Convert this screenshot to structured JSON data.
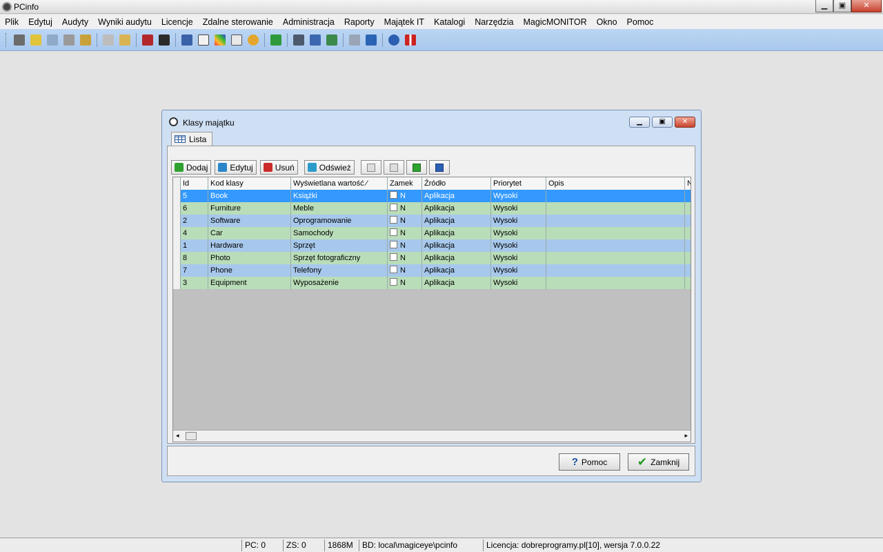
{
  "app": {
    "title": "PCinfo"
  },
  "window_controls": {
    "minimize": "▁",
    "maximize": "▣",
    "close": "✕"
  },
  "menu": [
    "Plik",
    "Edytuj",
    "Audyty",
    "Wyniki audytu",
    "Licencje",
    "Zdalne sterowanie",
    "Administracja",
    "Raporty",
    "Majątek IT",
    "Katalogi",
    "Narzędzia",
    "MagicMONITOR",
    "Okno",
    "Pomoc"
  ],
  "toolbar_icons": [
    "tools-icon",
    "upload-icon",
    "audit-icon",
    "search-icon",
    "wand-icon",
    "printer-icon",
    "chart-icon",
    "book-icon",
    "monitor-icon",
    "building-icon",
    "window-icon",
    "palette-icon",
    "list-icon",
    "user-icon",
    "money-icon",
    "network-icon",
    "computers-icon",
    "computers-alt-icon",
    "folder-icon",
    "doc-icon",
    "help-icon",
    "uk-flag-icon"
  ],
  "child_window": {
    "title": "Klasy majątku",
    "tab_label": "Lista",
    "buttons": {
      "add": "Dodaj",
      "edit": "Edytuj",
      "delete": "Usuń",
      "refresh": "Odśwież"
    },
    "columns": [
      "Id",
      "Kod klasy",
      "Wyświetlana wartość",
      "Zamek",
      "Źródło",
      "Priorytet",
      "Opis",
      "N"
    ],
    "sort_marker": "⁄",
    "rows": [
      {
        "id": "5",
        "code": "Book",
        "display": "Książki",
        "lock": "N",
        "source": "Aplikacja",
        "priority": "Wysoki",
        "desc": ""
      },
      {
        "id": "6",
        "code": "Furniture",
        "display": "Meble",
        "lock": "N",
        "source": "Aplikacja",
        "priority": "Wysoki",
        "desc": ""
      },
      {
        "id": "2",
        "code": "Software",
        "display": "Oprogramowanie",
        "lock": "N",
        "source": "Aplikacja",
        "priority": "Wysoki",
        "desc": ""
      },
      {
        "id": "4",
        "code": "Car",
        "display": "Samochody",
        "lock": "N",
        "source": "Aplikacja",
        "priority": "Wysoki",
        "desc": ""
      },
      {
        "id": "1",
        "code": "Hardware",
        "display": "Sprzęt",
        "lock": "N",
        "source": "Aplikacja",
        "priority": "Wysoki",
        "desc": ""
      },
      {
        "id": "8",
        "code": "Photo",
        "display": "Sprzęt fotograficzny",
        "lock": "N",
        "source": "Aplikacja",
        "priority": "Wysoki",
        "desc": ""
      },
      {
        "id": "7",
        "code": "Phone",
        "display": "Telefony",
        "lock": "N",
        "source": "Aplikacja",
        "priority": "Wysoki",
        "desc": ""
      },
      {
        "id": "3",
        "code": "Equipment",
        "display": "Wyposażenie",
        "lock": "N",
        "source": "Aplikacja",
        "priority": "Wysoki",
        "desc": ""
      }
    ],
    "footer": {
      "help": "Pomoc",
      "close": "Zamknij"
    }
  },
  "status": {
    "pc": "PC: 0",
    "zs": "ZS: 0",
    "mem": "1868M",
    "db": "BD: local\\magiceye\\pcinfo",
    "license": "Licencja: dobreprogramy.pl[10], wersja 7.0.0.22"
  },
  "colors": {
    "selected_row": "#3399ff",
    "row_blue": "#a7c8ec",
    "row_green": "#b9ddb8",
    "toolbar": "#bcd6f3"
  }
}
